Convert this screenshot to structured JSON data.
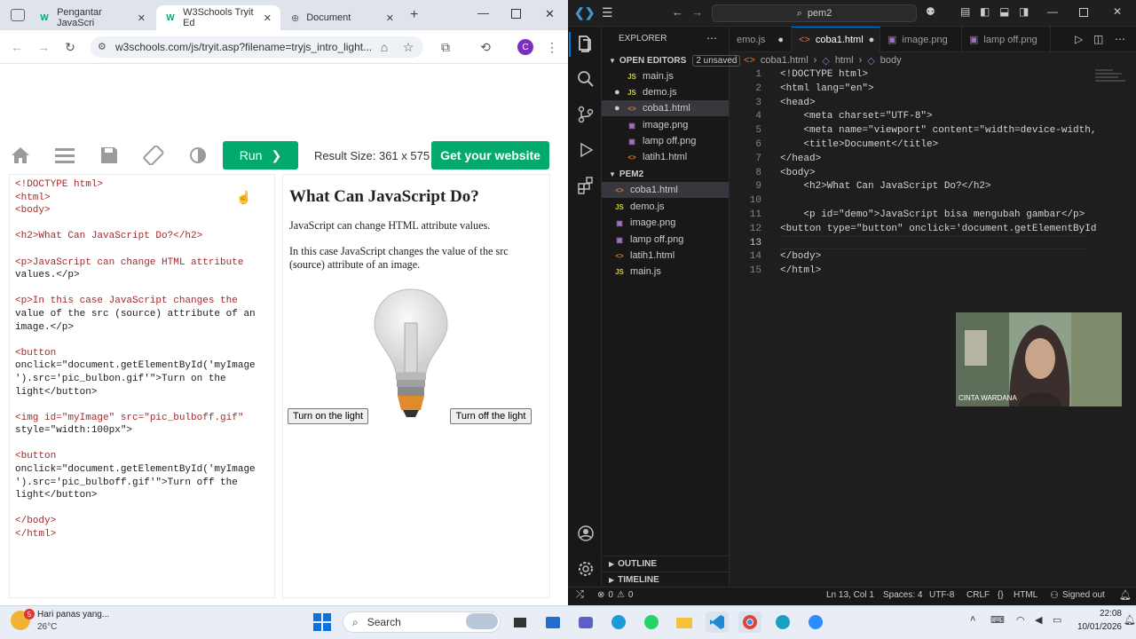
{
  "browser": {
    "tabs": [
      {
        "label": "Pengantar JavaScri",
        "active": false
      },
      {
        "label": "W3Schools Tryit Ed",
        "active": true
      },
      {
        "label": "Document",
        "active": false
      }
    ],
    "new_tab": "+",
    "url": "w3schools.com/js/tryit.asp?filename=tryjs_intro_light...",
    "profile_initial": "C"
  },
  "tryit": {
    "run_label": "Run",
    "run_arrow": "❯",
    "result_size": "Result Size: 361 x 575",
    "get_website": "Get your website",
    "source_lines": [
      "<!DOCTYPE html>",
      "<html>",
      "<body>",
      "",
      "<h2>What Can JavaScript Do?</h2>",
      "",
      "<p>JavaScript can change HTML attribute",
      "values.</p>",
      "",
      "<p>In this case JavaScript changes the",
      "value of the src (source) attribute of an",
      "image.</p>",
      "",
      "<button",
      "onclick=\"document.getElementById('myImage",
      "').src='pic_bulbon.gif'\">Turn on the",
      "light</button>",
      "",
      "<img id=\"myImage\" src=\"pic_bulboff.gif\"",
      "style=\"width:100px\">",
      "",
      "<button",
      "onclick=\"document.getElementById('myImage",
      "').src='pic_bulboff.gif'\">Turn off the",
      "light</button>",
      "",
      "</body>",
      "</html>"
    ],
    "result": {
      "heading": "What Can JavaScript Do?",
      "p1": "JavaScript can change HTML attribute values.",
      "p2": "In this case JavaScript changes the value of the src (source) attribute of an image.",
      "btn_on": "Turn on the light",
      "btn_off": "Turn off the light"
    }
  },
  "vscode": {
    "search": "pem2",
    "explorer_title": "EXPLORER",
    "open_editors": "OPEN EDITORS",
    "unsaved": "2 unsaved",
    "open_files": [
      "main.js",
      "demo.js",
      "coba1.html",
      "image.png",
      "lamp off.png",
      "latih1.html"
    ],
    "folder": "PEM2",
    "folder_files": [
      "coba1.html",
      "demo.js",
      "image.png",
      "lamp off.png",
      "latih1.html",
      "main.js"
    ],
    "outline": "OUTLINE",
    "timeline": "TIMELINE",
    "editor_tabs": [
      "emo.js",
      "coba1.html",
      "image.png",
      "lamp off.png"
    ],
    "breadcrumb": [
      "coba1.html",
      "html",
      "body"
    ],
    "line_numbers": [
      "1",
      "2",
      "3",
      "4",
      "5",
      "6",
      "7",
      "8",
      "9",
      "10",
      "11",
      "12",
      "13",
      "14",
      "15"
    ],
    "code_lines": [
      "<!DOCTYPE html>",
      "<html lang=\"en\">",
      "<head>",
      "    <meta charset=\"UTF-8\">",
      "    <meta name=\"viewport\" content=\"width=device-width,",
      "    <title>Document</title>",
      "</head>",
      "<body>",
      "    <h2>What Can JavaScript Do?</h2>",
      "",
      "    <p id=\"demo\">JavaScript bisa mengubah gambar</p>",
      "<button type=\"button\" onclick='document.getElementById",
      "",
      "</body>",
      "</html>"
    ],
    "status": {
      "errors": "0",
      "warnings": "0",
      "position": "Ln 13, Col 1",
      "spaces": "Spaces: 4",
      "encoding": "UTF-8",
      "eol": "CRLF",
      "language": "HTML",
      "account": "Signed out"
    },
    "webcam_name": "CINTA WARDANA"
  },
  "taskbar": {
    "weather_text": "Hari panas yang...",
    "temp": "26°C",
    "badge": "5",
    "search_label": "Search",
    "time": "22:08",
    "date": "10/01/2026"
  }
}
